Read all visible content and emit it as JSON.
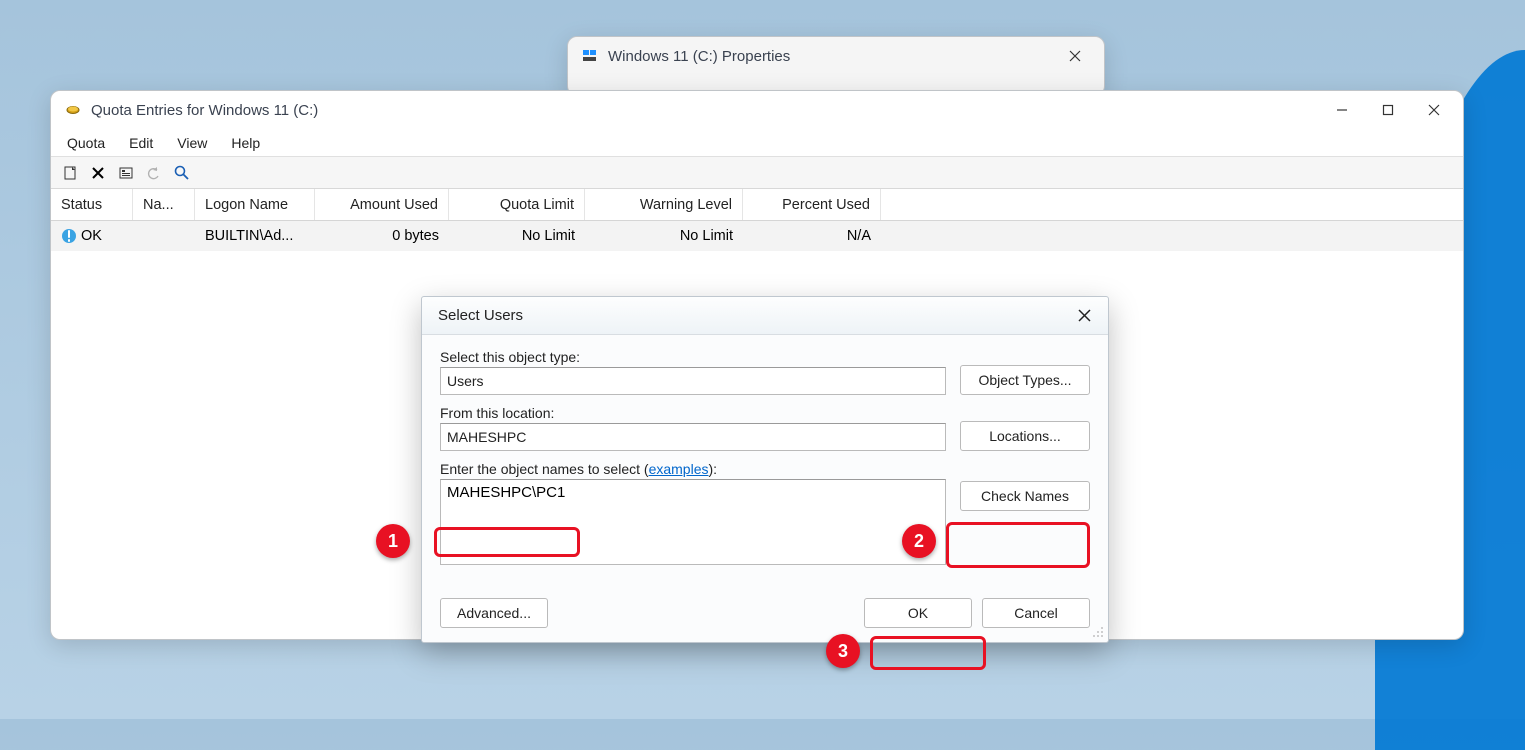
{
  "properties_window": {
    "title": "Windows 11 (C:) Properties"
  },
  "quota_window": {
    "title": "Quota Entries for Windows 11 (C:)",
    "menu": {
      "quota": "Quota",
      "edit": "Edit",
      "view": "View",
      "help": "Help"
    },
    "columns": {
      "status": "Status",
      "name": "Na...",
      "logon": "Logon Name",
      "amount": "Amount Used",
      "limit": "Quota Limit",
      "warning": "Warning Level",
      "percent": "Percent Used"
    },
    "rows": [
      {
        "status": "OK",
        "name": "",
        "logon": "BUILTIN\\Ad...",
        "amount": "0 bytes",
        "limit": "No Limit",
        "warning": "No Limit",
        "percent": "N/A"
      }
    ]
  },
  "dialog": {
    "title": "Select Users",
    "object_type_label": "Select this object type:",
    "object_type_value": "Users",
    "object_types_btn": "Object Types...",
    "location_label": "From this location:",
    "location_value": "MAHESHPC",
    "locations_btn": "Locations...",
    "names_label_prefix": "Enter the object names to select (",
    "names_label_link": "examples",
    "names_label_suffix": "):",
    "names_value": "MAHESHPC\\PC1",
    "check_names_btn": "Check Names",
    "advanced_btn": "Advanced...",
    "ok_btn": "OK",
    "cancel_btn": "Cancel"
  },
  "annotations": {
    "b1": "1",
    "b2": "2",
    "b3": "3"
  }
}
